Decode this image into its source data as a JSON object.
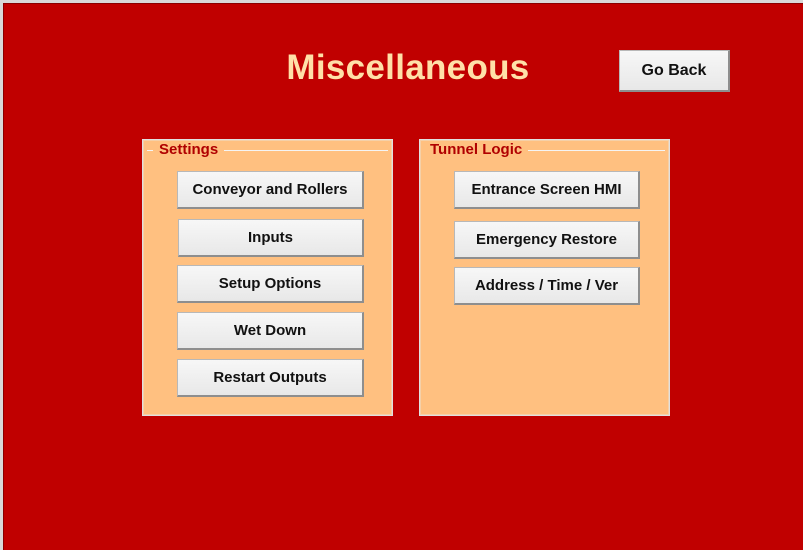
{
  "header": {
    "title": "Miscellaneous",
    "go_back_label": "Go Back"
  },
  "settings": {
    "title": "Settings",
    "buttons": [
      "Conveyor and Rollers",
      "Inputs",
      "Setup Options",
      "Wet Down",
      "Restart Outputs"
    ]
  },
  "tunnel_logic": {
    "title": "Tunnel Logic",
    "buttons": [
      "Entrance Screen HMI",
      "Emergency Restore",
      "Address / Time / Ver"
    ]
  },
  "colors": {
    "background": "#c00000",
    "title_text": "#ffe0a8",
    "group_fill": "#ffc080",
    "group_title_text": "#b00000",
    "button_face": "#f0f0f0"
  }
}
